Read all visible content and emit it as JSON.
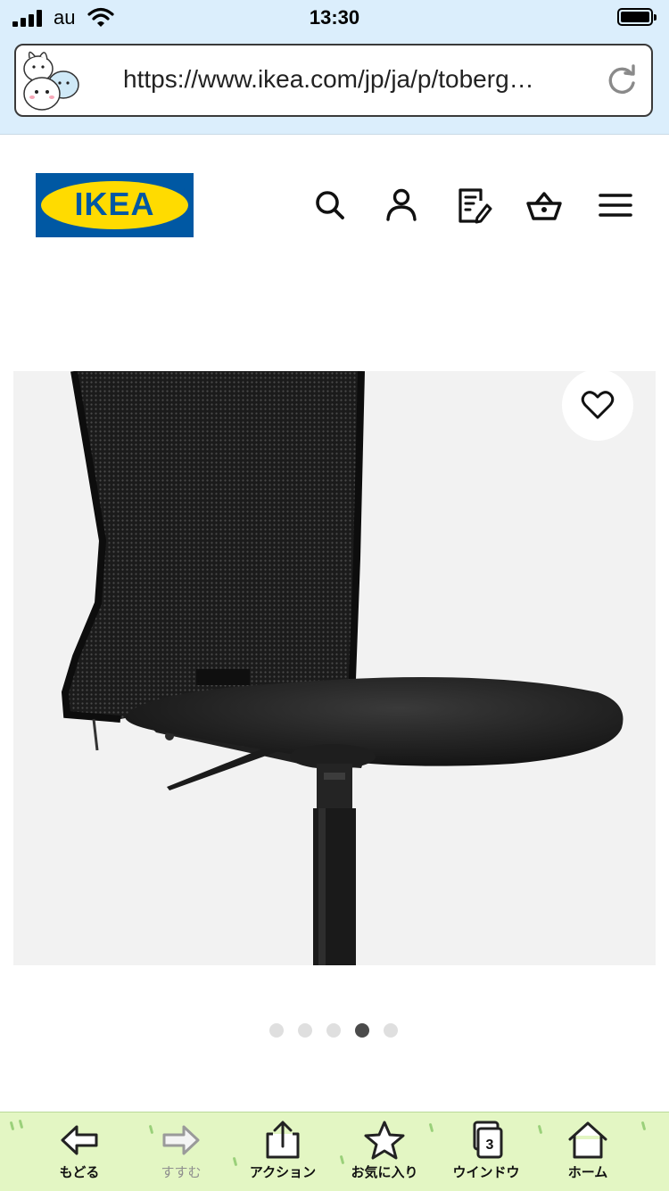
{
  "status_bar": {
    "carrier": "au",
    "time": "13:30"
  },
  "browser": {
    "url": "https://www.ikea.com/jp/ja/p/toberg…"
  },
  "header": {
    "logo_text": "IKEA",
    "icons": [
      "search-icon",
      "account-icon",
      "shopping-list-icon",
      "basket-icon",
      "menu-icon"
    ]
  },
  "product": {
    "image": "black mesh-back office chair without armrests (partial view)",
    "favorite_icon": "heart-outline-icon"
  },
  "carousel": {
    "count": 5,
    "active_index": 3
  },
  "toolbar": {
    "back_label": "もどる",
    "forward_label": "すすむ",
    "action_label": "アクション",
    "bookmarks_label": "お気に入り",
    "windows_label": "ウインドウ",
    "windows_count": "3",
    "home_label": "ホーム"
  },
  "colors": {
    "ikea_blue": "#0058a3",
    "ikea_yellow": "#ffdb00",
    "browser_bar": "#dbeefc",
    "toolbar_bg": "#e3f6c3"
  }
}
